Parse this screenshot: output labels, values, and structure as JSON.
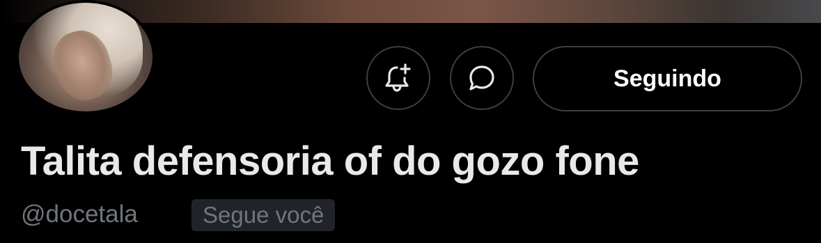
{
  "profile": {
    "display_name": "Talita defensoria of do gozo fone",
    "handle": "@docetala",
    "follows_you_badge": "Segue você"
  },
  "actions": {
    "follow_label": "Seguindo",
    "notify_icon": "bell-plus-icon",
    "message_icon": "chat-bubble-icon"
  },
  "colors": {
    "background": "#000000",
    "text_primary": "#e7e9ea",
    "text_secondary": "#71767b",
    "button_border": "#3c3f44",
    "badge_background": "#202327"
  }
}
